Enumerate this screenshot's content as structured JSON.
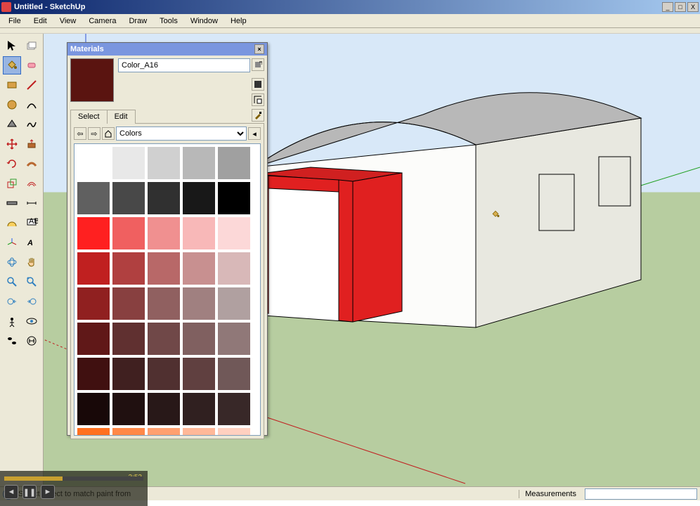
{
  "app": {
    "title": "Untitled - SketchUp"
  },
  "window_buttons": {
    "min": "_",
    "max": "□",
    "close": "X"
  },
  "menu": [
    "File",
    "Edit",
    "View",
    "Camera",
    "Draw",
    "Tools",
    "Window",
    "Help"
  ],
  "materials": {
    "title": "Materials",
    "current_name": "Color_A16",
    "current_color": "#5a1410",
    "tabs": {
      "select": "Select",
      "edit": "Edit"
    },
    "dropdown": "Colors",
    "swatches": [
      [
        "#ffffff",
        "#e8e8e8",
        "#d0d0d0",
        "#b8b8b8",
        "#a0a0a0"
      ],
      [
        "#606060",
        "#484848",
        "#303030",
        "#181818",
        "#000000"
      ],
      [
        "#ff2020",
        "#f06060",
        "#f09090",
        "#f8b8b8",
        "#fcd8d8"
      ],
      [
        "#c02020",
        "#b04040",
        "#b86868",
        "#c89090",
        "#d8b8b8"
      ],
      [
        "#902020",
        "#884040",
        "#906060",
        "#a08080",
        "#b0a0a0"
      ],
      [
        "#601818",
        "#603030",
        "#704848",
        "#806060",
        "#907878"
      ],
      [
        "#401010",
        "#402020",
        "#503030",
        "#604040",
        "#705858"
      ],
      [
        "#180808",
        "#201010",
        "#281818",
        "#302020",
        "#382828"
      ],
      [
        "#ff7020",
        "#ff8848",
        "#ffa070",
        "#ffb898",
        "#ffd0c0"
      ]
    ]
  },
  "status": {
    "hint": "Select object to match paint from",
    "measurements_label": "Measurements"
  },
  "video": {
    "time": "2:52"
  }
}
